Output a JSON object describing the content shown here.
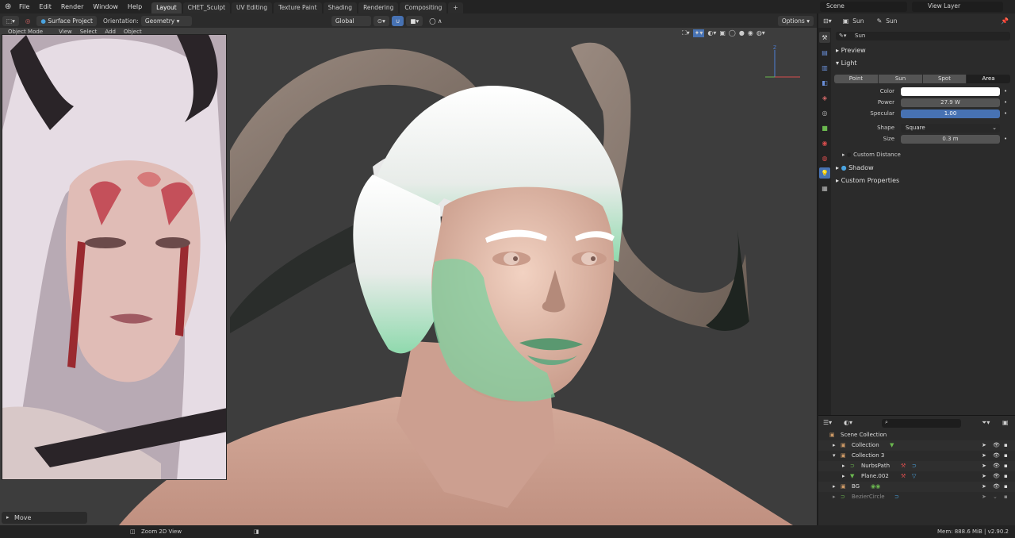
{
  "menu": [
    "File",
    "Edit",
    "Render",
    "Window",
    "Help"
  ],
  "workspaces": [
    "Layout",
    "CHET_Sculpt",
    "UV Editing",
    "Texture Paint",
    "Shading",
    "Rendering",
    "Compositing",
    "+"
  ],
  "active_workspace": "Layout",
  "scene": {
    "label": "Scene",
    "view_layer": "View Layer"
  },
  "header": {
    "tool": "Surface Project",
    "orientation_label": "Orientation:",
    "orientation_value": "Geometry",
    "transform": "Global",
    "options": "Options"
  },
  "viewport_sub": [
    "Object Mode",
    "View",
    "Select",
    "Add",
    "Object"
  ],
  "gizmo": {
    "z": "Z",
    "x": "X",
    "y": "Y"
  },
  "last_op": "Move",
  "props": {
    "breadcrumb": [
      "Sun",
      "Sun"
    ],
    "datablock": "Sun",
    "preview": "Preview",
    "light": "Light",
    "light_types": [
      "Point",
      "Sun",
      "Spot",
      "Area"
    ],
    "active_type": "Area",
    "color_label": "Color",
    "color_value": "#ffffff",
    "power_label": "Power",
    "power_value": "27.9 W",
    "specular_label": "Specular",
    "specular_value": "1.00",
    "specular_fill": 1.0,
    "shape_label": "Shape",
    "shape_value": "Square",
    "size_label": "Size",
    "size_value": "0.3 m",
    "custom_distance": "Custom Distance",
    "shadow": "Shadow",
    "custom_properties": "Custom Properties"
  },
  "outliner": {
    "root": "Scene Collection",
    "items": [
      {
        "name": "Collection"
      },
      {
        "name": "Collection 3"
      },
      {
        "name": "NurbsPath"
      },
      {
        "name": "Plane.002"
      },
      {
        "name": "BG"
      },
      {
        "name": "BezierCircle"
      }
    ]
  },
  "status": {
    "zoom": "Zoom 2D View",
    "mem": "Mem: 888.6 MiB | v2.90.2"
  },
  "colors": {
    "accent": "#4772b3",
    "active_tab": "#3d3d3d",
    "viewport": "#3d3d3d"
  }
}
